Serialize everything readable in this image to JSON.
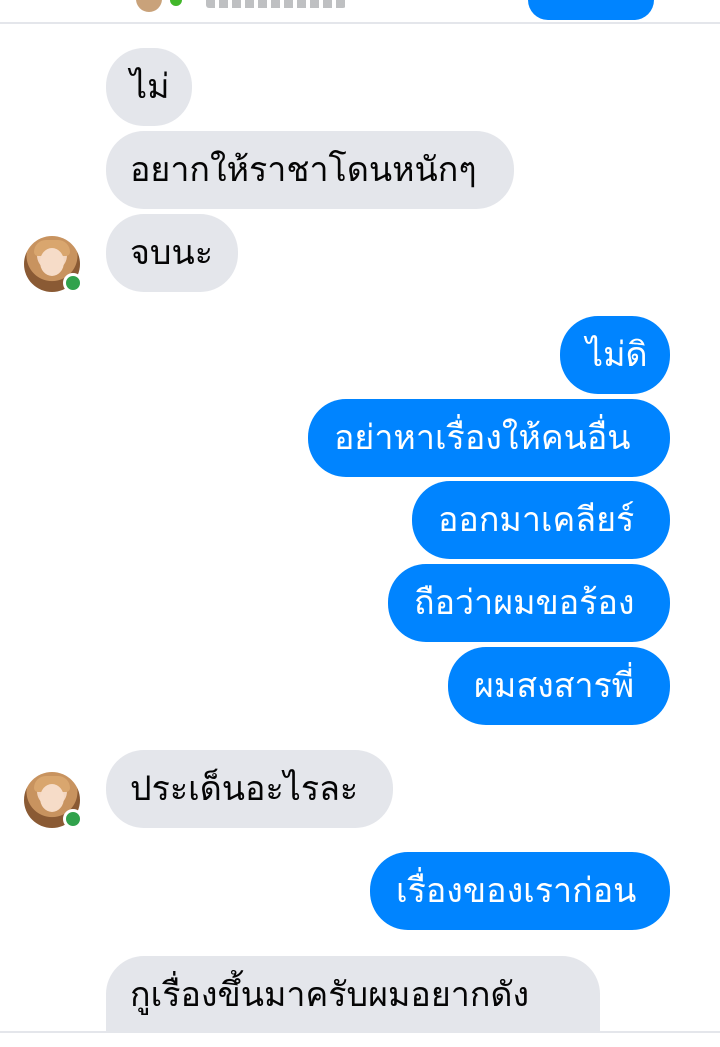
{
  "colors": {
    "incoming_bubble": "#e4e6eb",
    "outgoing_bubble": "#0084ff",
    "online_status": "#31a24c"
  },
  "icons": {
    "contact_avatar": "contact-avatar-icon",
    "online": "online-status-icon"
  },
  "messages": [
    {
      "side": "incoming",
      "text": "ไม่"
    },
    {
      "side": "incoming",
      "text": "อยากให้ราชาโดนหนักๆ"
    },
    {
      "side": "incoming",
      "text": "จบนะ"
    },
    {
      "side": "outgoing",
      "text": "ไม่ดิ"
    },
    {
      "side": "outgoing",
      "text": "อย่าหาเรื่องให้คนอื่น"
    },
    {
      "side": "outgoing",
      "text": "ออกมาเคลียร์"
    },
    {
      "side": "outgoing",
      "text": "ถือว่าผมขอร้อง"
    },
    {
      "side": "outgoing",
      "text": "ผมสงสารพี่"
    },
    {
      "side": "incoming",
      "text": "ประเด็นอะไรละ"
    },
    {
      "side": "outgoing",
      "text": "เรื่องของเราก่อน"
    },
    {
      "side": "incoming",
      "text": "กูเรื่องขึ้นมาครับผมอยากดัง"
    }
  ]
}
